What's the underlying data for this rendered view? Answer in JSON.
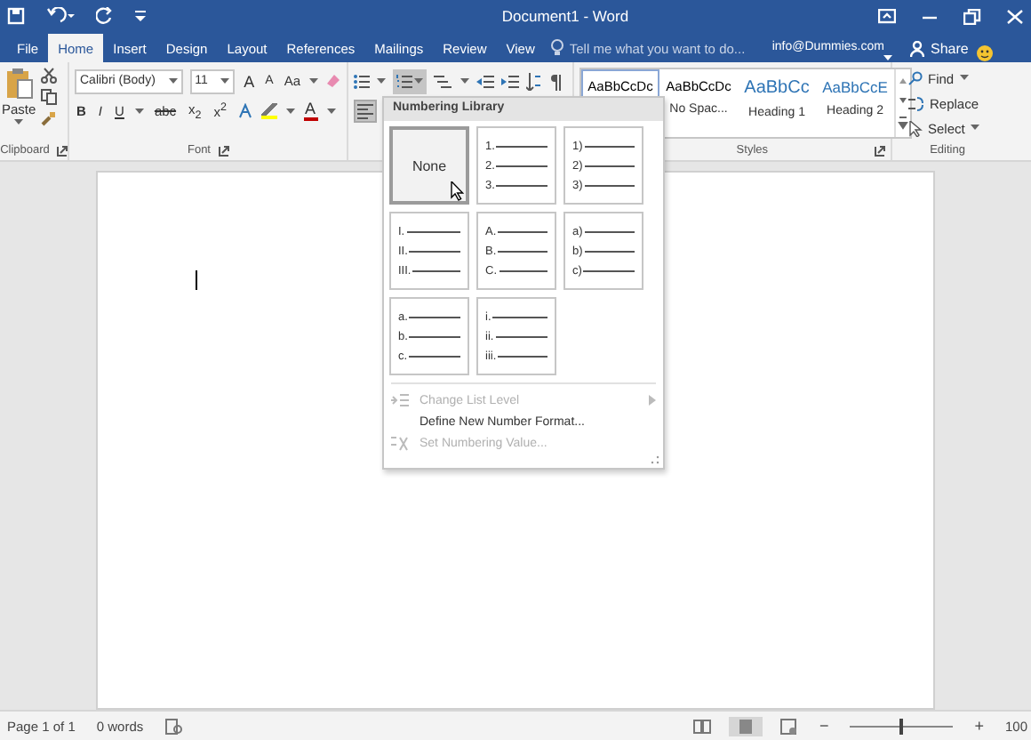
{
  "window": {
    "title": "Document1 - Word"
  },
  "tabs": [
    {
      "label": "File",
      "selected": false
    },
    {
      "label": "Home",
      "selected": true
    },
    {
      "label": "Insert",
      "selected": false
    },
    {
      "label": "Design",
      "selected": false
    },
    {
      "label": "Layout",
      "selected": false
    },
    {
      "label": "References",
      "selected": false
    },
    {
      "label": "Mailings",
      "selected": false
    },
    {
      "label": "Review",
      "selected": false
    },
    {
      "label": "View",
      "selected": false
    }
  ],
  "tell_me": {
    "placeholder": "Tell me what you want to do..."
  },
  "account": "info@Dummies.com",
  "share": "Share",
  "clipboard": {
    "paste": "Paste",
    "label": "Clipboard"
  },
  "font": {
    "label": "Font",
    "font_name": "Calibri (Body)",
    "font_size": "11",
    "size_buttons": [
      "A",
      "A"
    ],
    "case_button": "Aa",
    "format_buttons": [
      "B",
      "I",
      "U",
      "abc",
      "x$_{2}$",
      "x$^{2}$"
    ],
    "font_color_label": "A"
  },
  "paragraph": {
    "numbering_pressed": true
  },
  "styles": {
    "label": "Styles",
    "items": [
      {
        "preview": "AaBbCcDc",
        "kind": "body",
        "selected": true
      },
      {
        "preview": "AaBbCcDc",
        "name": "No Spac...",
        "kind": "body",
        "selected": false
      },
      {
        "preview": "AaBbCc",
        "name": "Heading 1",
        "kind": "heading1",
        "selected": false
      },
      {
        "preview": "AaBbCcE",
        "name": "Heading 2",
        "kind": "heading2",
        "selected": false
      }
    ]
  },
  "editing": {
    "label": "Editing",
    "items": [
      {
        "label": "Find",
        "kind": "find"
      },
      {
        "label": "Replace",
        "kind": "replace"
      },
      {
        "label": "Select",
        "kind": "select"
      }
    ]
  },
  "numbering_menu": {
    "title": "Numbering Library",
    "formats": [
      {
        "kind": "none",
        "label": "None",
        "selected": true
      },
      {
        "kind": "list",
        "markers": [
          "1.",
          "2.",
          "3."
        ],
        "selected": false
      },
      {
        "kind": "list",
        "markers": [
          "1)",
          "2)",
          "3)"
        ],
        "selected": false
      },
      {
        "kind": "list",
        "markers": [
          "I.",
          "II.",
          "III."
        ],
        "selected": false
      },
      {
        "kind": "list",
        "markers": [
          "A.",
          "B.",
          "C."
        ],
        "selected": false
      },
      {
        "kind": "list",
        "markers": [
          "a)",
          "b)",
          "c)"
        ],
        "selected": false
      },
      {
        "kind": "list",
        "markers": [
          "a.",
          "b.",
          "c."
        ],
        "selected": false
      },
      {
        "kind": "list",
        "markers": [
          "i.",
          "ii.",
          "iii."
        ],
        "selected": false
      }
    ],
    "commands": [
      {
        "label": "Change List Level",
        "kind": "level",
        "disabled": true
      },
      {
        "label": "Define New Number Format...",
        "kind": "define",
        "disabled": false
      },
      {
        "label": "Set Numbering Value...",
        "kind": "value",
        "disabled": true
      }
    ]
  },
  "status_bar": {
    "page": "Page 1 of 1",
    "words": "0 words",
    "zoom_out": "−",
    "zoom_slider": {
      "level": 0.5
    },
    "zoom_in": "+",
    "zoom": "100"
  }
}
